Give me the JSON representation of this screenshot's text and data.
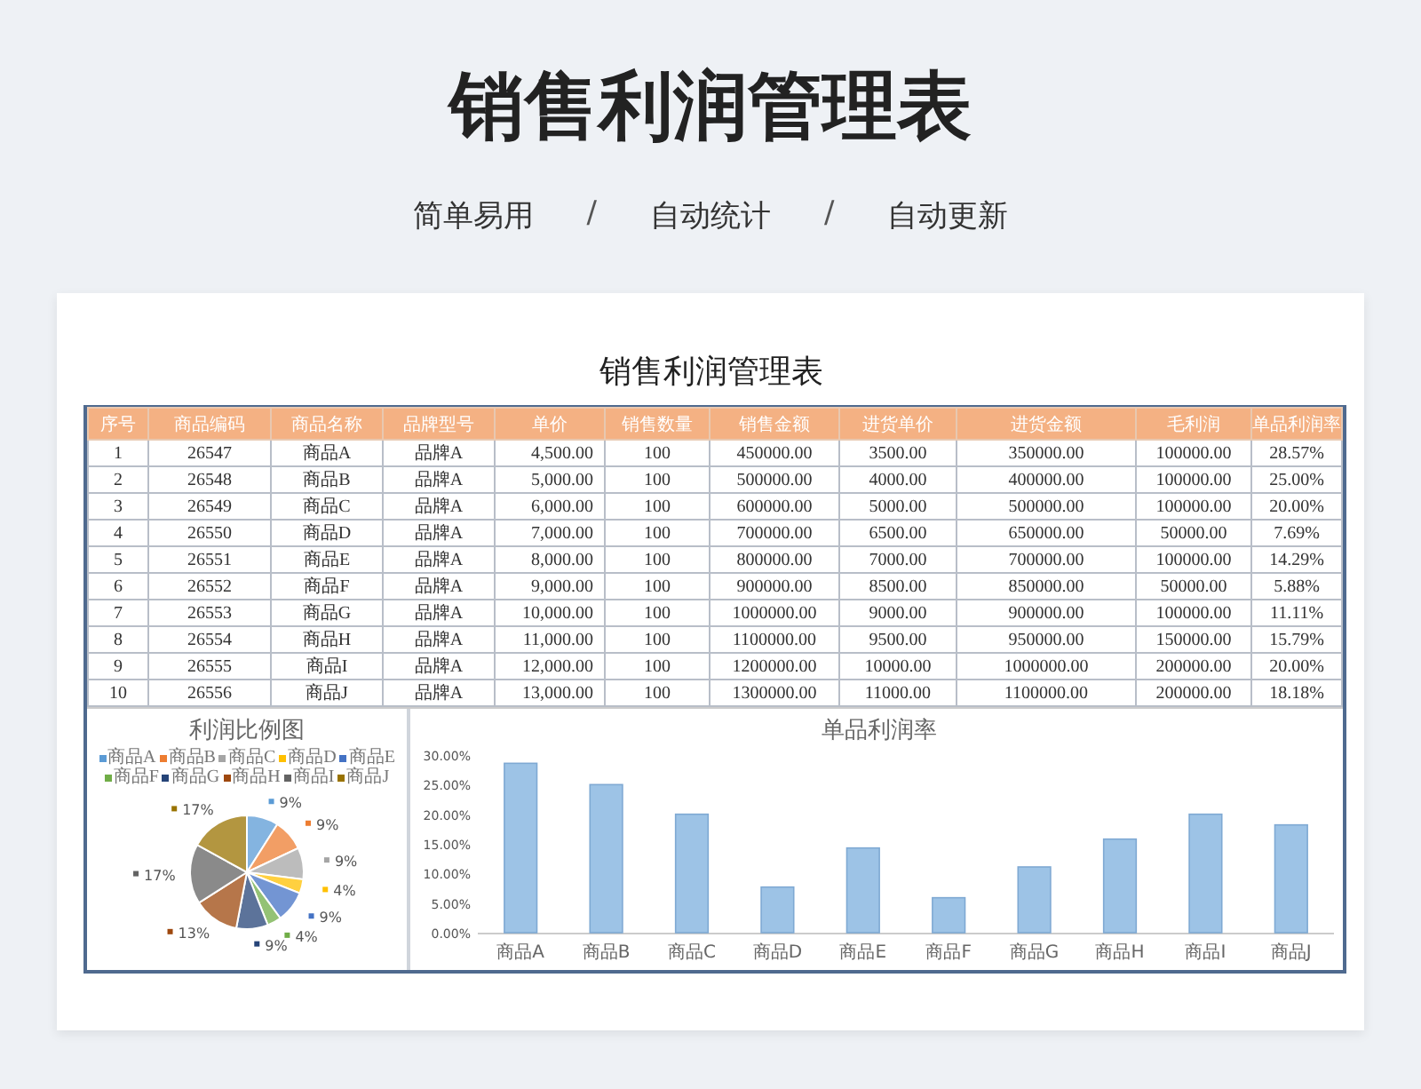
{
  "header": {
    "title": "销售利润管理表",
    "features": [
      "简单易用",
      "自动统计",
      "自动更新"
    ],
    "separators": [
      "/",
      "/"
    ]
  },
  "sheet": {
    "title": "销售利润管理表",
    "table": {
      "columns": [
        "序号",
        "商品编码",
        "商品名称",
        "品牌型号",
        "单价",
        "销售数量",
        "销售金额",
        "进货单价",
        "进货金额",
        "毛利润",
        "单品利润率"
      ],
      "rows": [
        [
          "1",
          "26547",
          "商品A",
          "品牌A",
          "4,500.00",
          "100",
          "450000.00",
          "3500.00",
          "350000.00",
          "100000.00",
          "28.57%"
        ],
        [
          "2",
          "26548",
          "商品B",
          "品牌A",
          "5,000.00",
          "100",
          "500000.00",
          "4000.00",
          "400000.00",
          "100000.00",
          "25.00%"
        ],
        [
          "3",
          "26549",
          "商品C",
          "品牌A",
          "6,000.00",
          "100",
          "600000.00",
          "5000.00",
          "500000.00",
          "100000.00",
          "20.00%"
        ],
        [
          "4",
          "26550",
          "商品D",
          "品牌A",
          "7,000.00",
          "100",
          "700000.00",
          "6500.00",
          "650000.00",
          "50000.00",
          "7.69%"
        ],
        [
          "5",
          "26551",
          "商品E",
          "品牌A",
          "8,000.00",
          "100",
          "800000.00",
          "7000.00",
          "700000.00",
          "100000.00",
          "14.29%"
        ],
        [
          "6",
          "26552",
          "商品F",
          "品牌A",
          "9,000.00",
          "100",
          "900000.00",
          "8500.00",
          "850000.00",
          "50000.00",
          "5.88%"
        ],
        [
          "7",
          "26553",
          "商品G",
          "品牌A",
          "10,000.00",
          "100",
          "1000000.00",
          "9000.00",
          "900000.00",
          "100000.00",
          "11.11%"
        ],
        [
          "8",
          "26554",
          "商品H",
          "品牌A",
          "11,000.00",
          "100",
          "1100000.00",
          "9500.00",
          "950000.00",
          "150000.00",
          "15.79%"
        ],
        [
          "9",
          "26555",
          "商品I",
          "品牌A",
          "12,000.00",
          "100",
          "1200000.00",
          "10000.00",
          "1000000.00",
          "200000.00",
          "20.00%"
        ],
        [
          "10",
          "26556",
          "商品J",
          "品牌A",
          "13,000.00",
          "100",
          "1300000.00",
          "11000.00",
          "1100000.00",
          "200000.00",
          "18.18%"
        ]
      ]
    },
    "pie_chart": {
      "chart_data": {
        "type": "pie",
        "title": "利润比例图",
        "categories": [
          "商品A",
          "商品B",
          "商品C",
          "商品D",
          "商品E",
          "商品F",
          "商品G",
          "商品H",
          "商品I",
          "商品J"
        ],
        "values": [
          9,
          9,
          9,
          4,
          9,
          4,
          9,
          13,
          17,
          17
        ],
        "value_labels": [
          "9%",
          "9%",
          "9%",
          "4%",
          "9%",
          "4%",
          "9%",
          "13%",
          "17%",
          "17%"
        ]
      }
    },
    "bar_chart": {
      "chart_data": {
        "type": "bar",
        "title": "单品利润率",
        "categories": [
          "商品A",
          "商品B",
          "商品C",
          "商品D",
          "商品E",
          "商品F",
          "商品G",
          "商品H",
          "商品I",
          "商品J"
        ],
        "values": [
          28.6,
          25.0,
          20.0,
          7.7,
          14.3,
          5.9,
          11.1,
          15.8,
          20.0,
          18.2
        ],
        "ylim": [
          0,
          30
        ],
        "yticks": [
          {
            "value": 0,
            "label": "0.00%"
          },
          {
            "value": 5,
            "label": "5.00%"
          },
          {
            "value": 10,
            "label": "10.00%"
          },
          {
            "value": 15,
            "label": "15.00%"
          },
          {
            "value": 20,
            "label": "20.00%"
          },
          {
            "value": 25,
            "label": "25.00%"
          },
          {
            "value": 30,
            "label": "30.00%"
          }
        ]
      }
    }
  }
}
